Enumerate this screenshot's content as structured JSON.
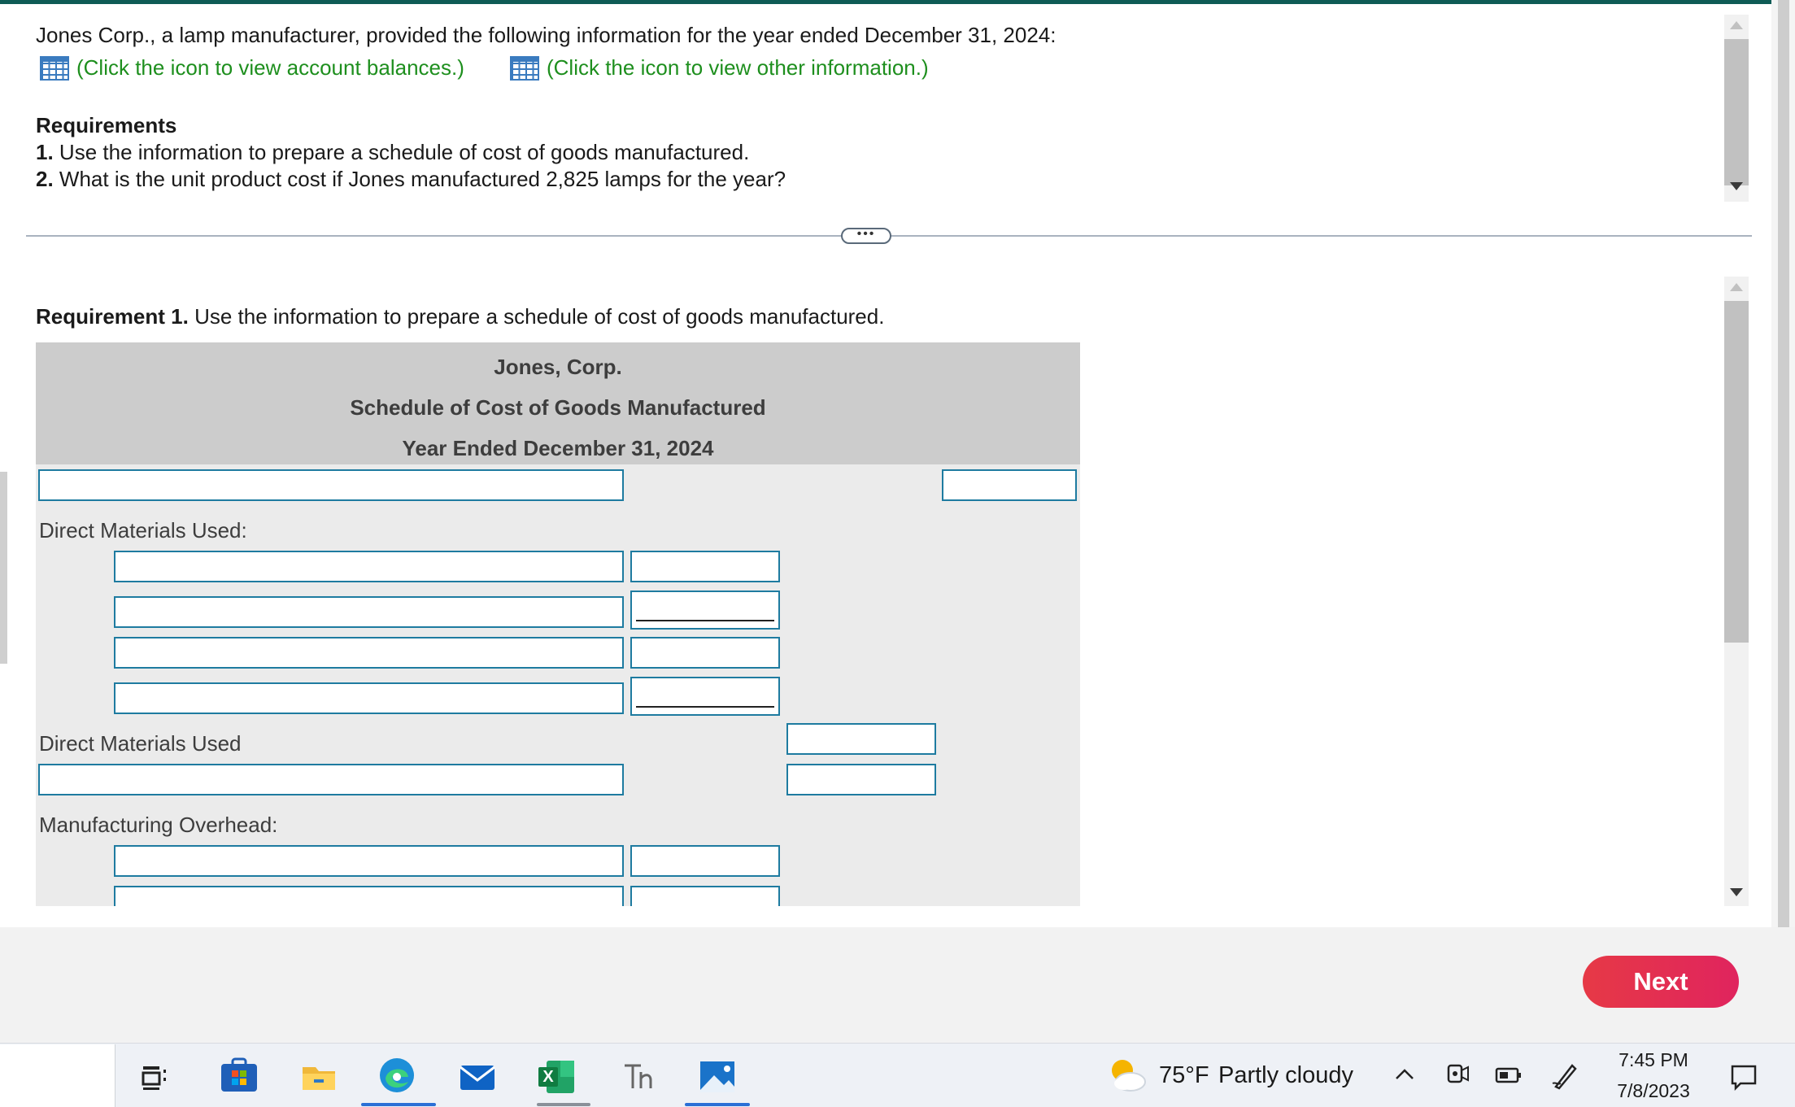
{
  "intro": {
    "text": "Jones Corp., a lamp manufacturer, provided the following information for the year ended December 31, 2024:",
    "link_balances": "(Click the icon to view account balances.)",
    "link_other": "(Click the icon to view other information.)"
  },
  "requirements": {
    "heading": "Requirements",
    "items": [
      {
        "num": "1.",
        "text": "Use the information to prepare a schedule of cost of goods manufactured."
      },
      {
        "num": "2.",
        "text": "What is the unit product cost if Jones manufactured 2,825 lamps for the year?"
      }
    ]
  },
  "divider": {
    "dots": "•••"
  },
  "req1": {
    "label": "Requirement 1.",
    "text": "Use the information to prepare a schedule of cost of goods manufactured."
  },
  "schedule": {
    "company": "Jones, Corp.",
    "title": "Schedule of Cost of Goods Manufactured",
    "period": "Year Ended December 31, 2024",
    "labels": {
      "dm_used_header": "Direct Materials Used:",
      "dm_used_total": "Direct Materials Used",
      "mfg_overhead": "Manufacturing Overhead:"
    }
  },
  "footer": {
    "next_label": "Next"
  },
  "taskbar": {
    "weather_temp": "75°F",
    "weather_desc": "Partly cloudy",
    "time": "7:45 PM",
    "date": "7/8/2023",
    "excel_letter": "X",
    "colors": {
      "accent": "#2b6fd6",
      "next": "#e6304a",
      "link": "#1e8f1e",
      "input_border": "#1e7ba0"
    }
  }
}
